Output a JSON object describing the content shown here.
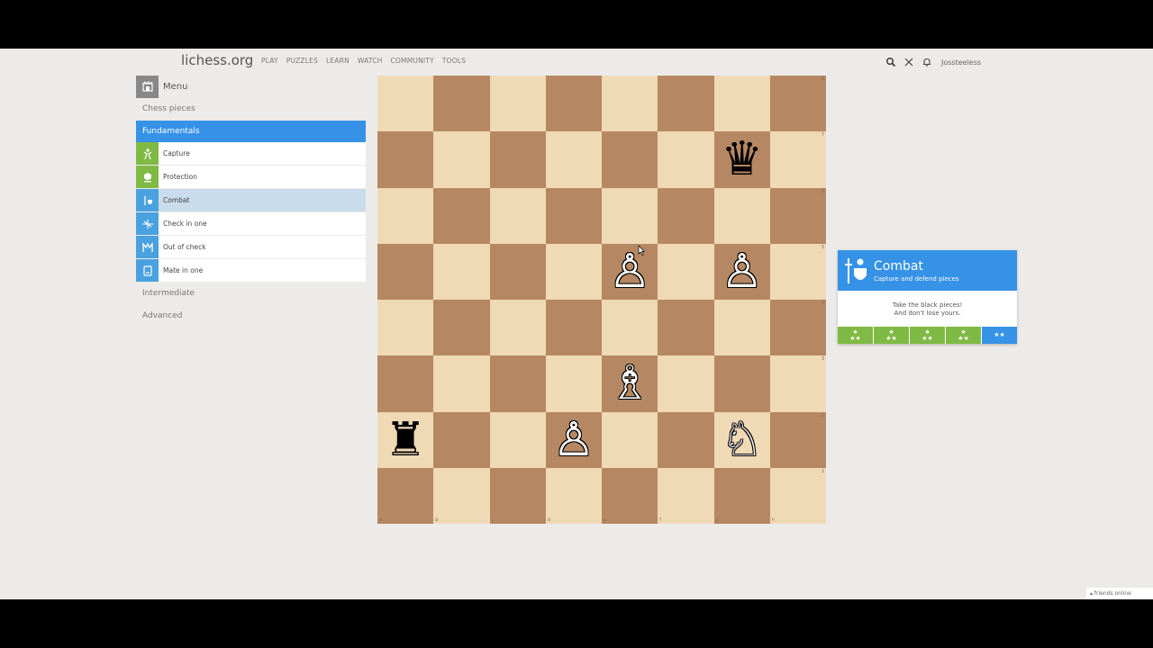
{
  "header": {
    "logo": "lichess.org",
    "nav": [
      "PLAY",
      "PUZZLES",
      "LEARN",
      "WATCH",
      "COMMUNITY",
      "TOOLS"
    ],
    "username": "Jossteeless"
  },
  "sidebar": {
    "menu_label": "Menu",
    "chess_pieces": "Chess pieces",
    "fundamentals": "Fundamentals",
    "stages": [
      {
        "label": "Capture",
        "icon": "capture-icon",
        "color": "green"
      },
      {
        "label": "Protection",
        "icon": "protection-icon",
        "color": "green"
      },
      {
        "label": "Combat",
        "icon": "combat-icon",
        "color": "blue",
        "selected": true
      },
      {
        "label": "Check in one",
        "icon": "check-icon",
        "color": "blue"
      },
      {
        "label": "Out of check",
        "icon": "out-of-check-icon",
        "color": "blue"
      },
      {
        "label": "Mate in one",
        "icon": "mate-icon",
        "color": "blue"
      }
    ],
    "intermediate": "Intermediate",
    "advanced": "Advanced"
  },
  "board": {
    "pieces": [
      {
        "square": "g7",
        "piece": "queen",
        "color": "black",
        "glyph": "♛"
      },
      {
        "square": "e5",
        "piece": "pawn",
        "color": "white",
        "glyph": "♙"
      },
      {
        "square": "g5",
        "piece": "pawn",
        "color": "white",
        "glyph": "♙"
      },
      {
        "square": "e3",
        "piece": "bishop",
        "color": "white",
        "glyph": "♗"
      },
      {
        "square": "a2",
        "piece": "rook",
        "color": "black",
        "glyph": "♜"
      },
      {
        "square": "d2",
        "piece": "pawn",
        "color": "white",
        "glyph": "♙"
      },
      {
        "square": "g2",
        "piece": "knight",
        "color": "white",
        "glyph": "♘"
      }
    ],
    "ranks": [
      "8",
      "7",
      "6",
      "5",
      "4",
      "3",
      "2",
      "1"
    ],
    "files": [
      "a",
      "b",
      "c",
      "d",
      "e",
      "f",
      "g",
      "h"
    ]
  },
  "panel": {
    "title": "Combat",
    "subtitle": "Capture and defend pieces",
    "line1": "Take the black pieces!",
    "line2": "And don't lose yours.",
    "levels": [
      {
        "top": "★",
        "bottom": "★★"
      },
      {
        "top": "★",
        "bottom": "★★"
      },
      {
        "top": "★",
        "bottom": "★★"
      },
      {
        "top": "★",
        "bottom": "★★"
      },
      {
        "top": "",
        "bottom": "★★"
      }
    ]
  },
  "footer": {
    "friends": "▴ friends online"
  },
  "colors": {
    "accent": "#3692e7",
    "success": "#7fba44",
    "light_square": "#f0d9b5",
    "dark_square": "#b58863",
    "selected_stage": "#c9dcec"
  }
}
